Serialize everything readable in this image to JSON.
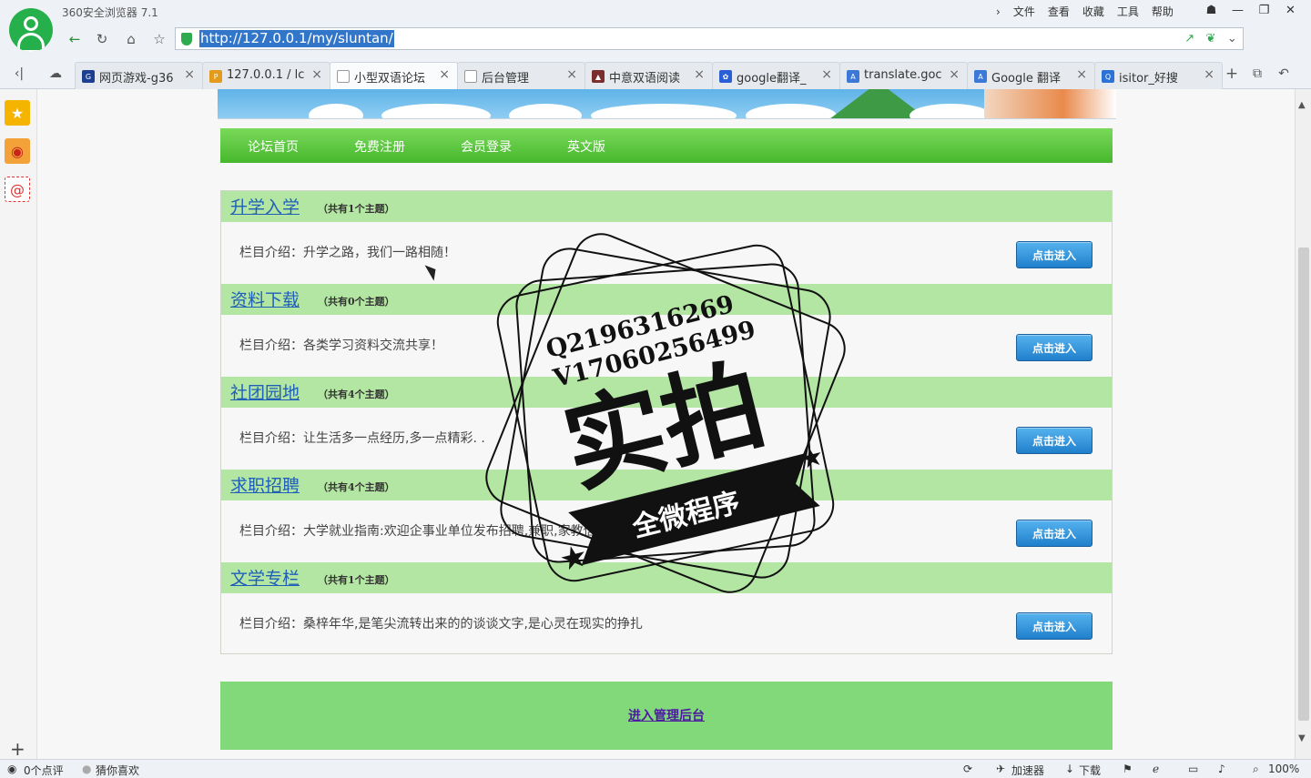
{
  "browser": {
    "app_title": "360安全浏览器 7.1",
    "menu": [
      "文件",
      "查看",
      "收藏",
      "工具",
      "帮助"
    ],
    "url": "http://127.0.0.1/my/sluntan/"
  },
  "tabs": [
    {
      "title": "网页游戏-g36",
      "favicon_color": "#1d3f92",
      "favicon_text": "G"
    },
    {
      "title": "127.0.0.1 / lc",
      "favicon_color": "#e39b1e",
      "favicon_text": "P"
    },
    {
      "title": "小型双语论坛",
      "favicon_color": "#ffffff",
      "favicon_text": "",
      "active": true
    },
    {
      "title": "后台管理",
      "favicon_color": "#ffffff",
      "favicon_text": ""
    },
    {
      "title": "中意双语阅读",
      "favicon_color": "#7a2e2e",
      "favicon_text": "▲"
    },
    {
      "title": "google翻译_",
      "favicon_color": "#2b5fd6",
      "favicon_text": "✿"
    },
    {
      "title": "translate.goc",
      "favicon_color": "#3c78d8",
      "favicon_text": "A"
    },
    {
      "title": "Google 翻译",
      "favicon_color": "#3c78d8",
      "favicon_text": "A"
    },
    {
      "title": "isitor_好搜",
      "favicon_color": "#2b72d6",
      "favicon_text": "Q"
    }
  ],
  "nav": {
    "home": "论坛首页",
    "register": "免费注册",
    "login": "会员登录",
    "english": "英文版"
  },
  "boards": [
    {
      "name": "升学入学",
      "count": "（共有1个主题）",
      "desc": "栏目介绍：升学之路，我们一路相随！",
      "button": "点击进入"
    },
    {
      "name": "资料下载",
      "count": "（共有0个主题）",
      "desc": "栏目介绍：各类学习资料交流共享！",
      "button": "点击进入"
    },
    {
      "name": "社团园地",
      "count": "（共有4个主题）",
      "desc": "栏目介绍：让生活多一点经历,多一点精彩. .",
      "button": "点击进入"
    },
    {
      "name": "求职招聘",
      "count": "（共有4个主题）",
      "desc": "栏目介绍：大学就业指南:欢迎企事业单位发布招聘,兼职,家教信息.",
      "button": "点击进入"
    },
    {
      "name": "文学专栏",
      "count": "（共有1个主题）",
      "desc": "栏目介绍：桑梓年华,是笔尖流转出来的的谈谈文字,是心灵在现实的挣扎",
      "button": "点击进入"
    }
  ],
  "footer": {
    "admin_link": "进入管理后台"
  },
  "watermark": {
    "line1": "Q2196316269",
    "line2": "V17060256499",
    "big": "实拍",
    "ribbon": "全微程序"
  },
  "status": {
    "comments": "0个点评",
    "guess": "猜你喜欢",
    "accelerator": "加速器",
    "download": "下载",
    "zoom": "100%"
  }
}
